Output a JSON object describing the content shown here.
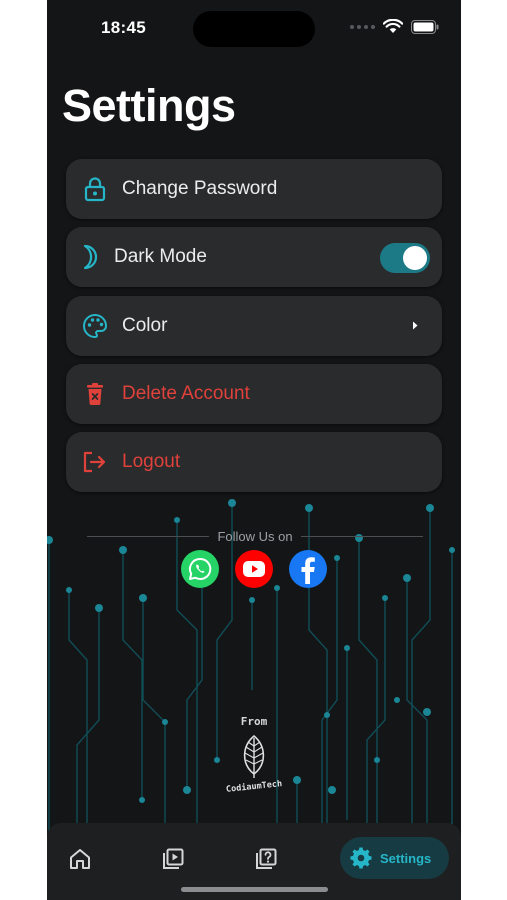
{
  "status_bar": {
    "time": "18:45"
  },
  "page": {
    "title": "Settings"
  },
  "menu": {
    "items": [
      {
        "label": "Change Password",
        "icon": "lock-icon"
      },
      {
        "label": "Dark Mode",
        "icon": "moon-icon",
        "toggle_on": true
      },
      {
        "label": "Color",
        "icon": "palette-icon"
      },
      {
        "label": "Delete Account",
        "icon": "trash-icon"
      },
      {
        "label": "Logout",
        "icon": "logout-icon"
      }
    ]
  },
  "social": {
    "heading": "Follow Us on",
    "links": [
      "whatsapp-icon",
      "youtube-icon",
      "facebook-icon"
    ]
  },
  "footer": {
    "from_label": "From",
    "brand": "CodiaumTech"
  },
  "tab_bar": {
    "items": [
      "home-icon",
      "video-library-icon",
      "quiz-icon"
    ],
    "active": {
      "icon": "gear-icon",
      "label": "Settings"
    }
  },
  "colors": {
    "background": "#141516",
    "card": "#2a2b2d",
    "accent": "#25b6c8",
    "danger": "#e0413a",
    "toggle": "#1c7a86",
    "whatsapp": "#25d366",
    "youtube": "#ff0000",
    "facebook": "#1877f2"
  }
}
